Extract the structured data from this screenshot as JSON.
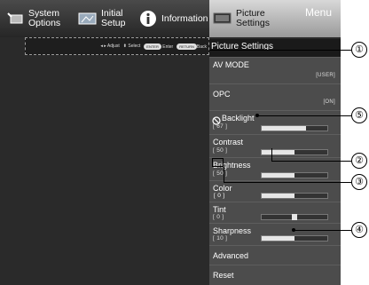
{
  "tabs": [
    {
      "label": "System\nOptions",
      "icon": "wrench-tv-icon"
    },
    {
      "label": "Initial\nSetup",
      "icon": "tv-setup-icon"
    },
    {
      "label": "Information",
      "icon": "info-icon"
    },
    {
      "label": "Picture\nSettings",
      "icon": "picture-tv-icon"
    }
  ],
  "menu_label": "Menu",
  "help_bar": {
    "adjust": "Adjust",
    "select": "Select",
    "enter_key": "ENTER",
    "enter": "Enter",
    "return_key": "RETURN",
    "back": "Back"
  },
  "page_title": "Picture Settings",
  "items": [
    {
      "name": "AV MODE",
      "value": "[USER]"
    },
    {
      "name": "OPC",
      "value": "[ON]"
    },
    {
      "name": "Backlight",
      "value": "[ 67 ]",
      "level": 0.67
    },
    {
      "name": "Contrast",
      "value": "[ 50 ]",
      "level": 0.5
    },
    {
      "name": "Brightness",
      "value": "[ 50 ]",
      "level": 0.5
    },
    {
      "name": "Color",
      "value": "[ 0 ]",
      "level": 0.5
    },
    {
      "name": "Tint",
      "value": "[ 0 ]",
      "level": 0.5
    },
    {
      "name": "Sharpness",
      "value": "[ 10 ]",
      "level": 0.5
    },
    {
      "name": "Advanced"
    },
    {
      "name": "Reset"
    }
  ],
  "callouts": [
    "①",
    "②",
    "③",
    "④",
    "⑤"
  ]
}
